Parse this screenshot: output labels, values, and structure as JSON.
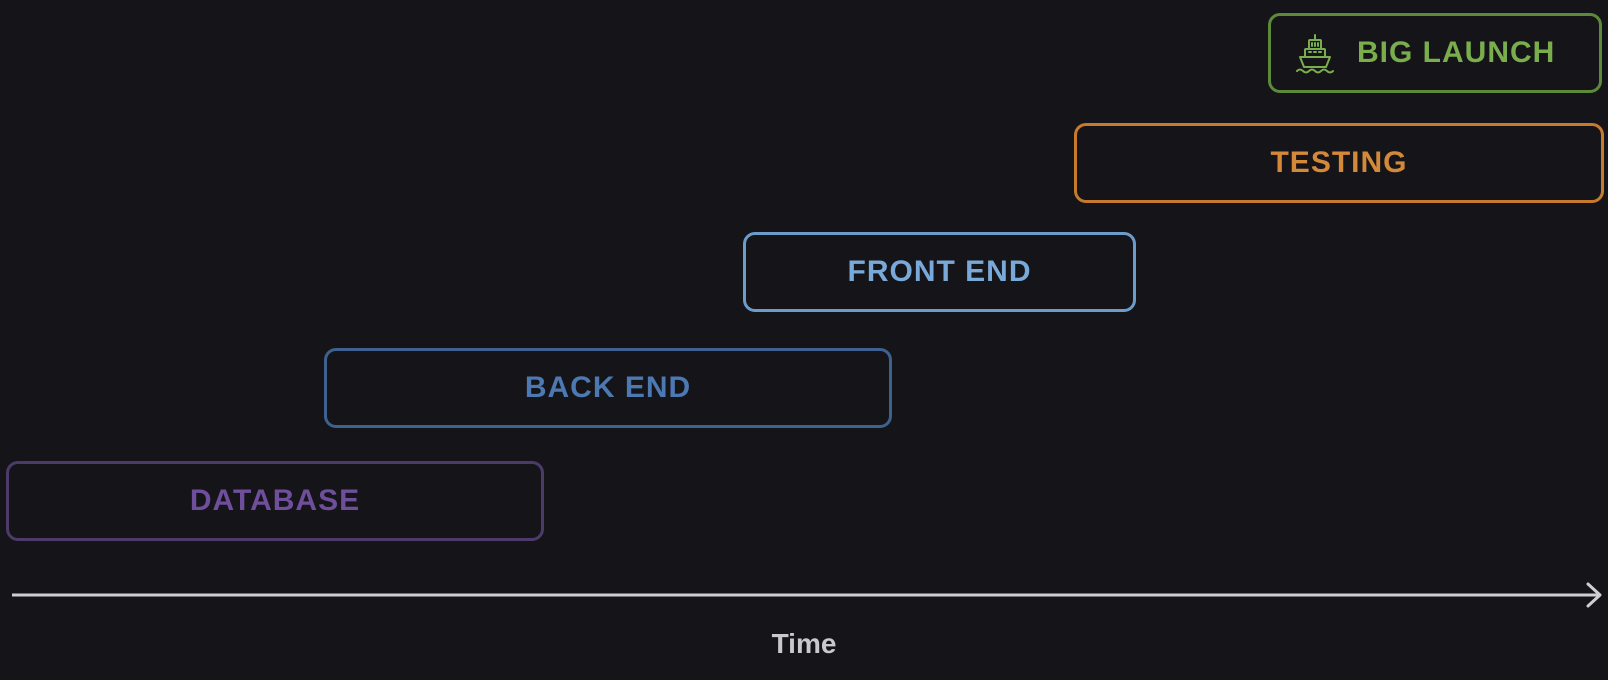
{
  "colors": {
    "background": "#151418",
    "database": "#6f4f9b",
    "backend": "#4d79b3",
    "frontend": "#78a9d8",
    "testing": "#d4883a",
    "launch": "#7aae4d",
    "axis": "#cfcfd2"
  },
  "phases": [
    {
      "key": "database",
      "label": "DATABASE"
    },
    {
      "key": "backend",
      "label": "BACK END"
    },
    {
      "key": "frontend",
      "label": "FRONT END"
    },
    {
      "key": "testing",
      "label": "TESTING"
    },
    {
      "key": "launch",
      "label": "BIG LAUNCH",
      "icon": "ship-icon"
    }
  ],
  "axis": {
    "label": "Time"
  }
}
